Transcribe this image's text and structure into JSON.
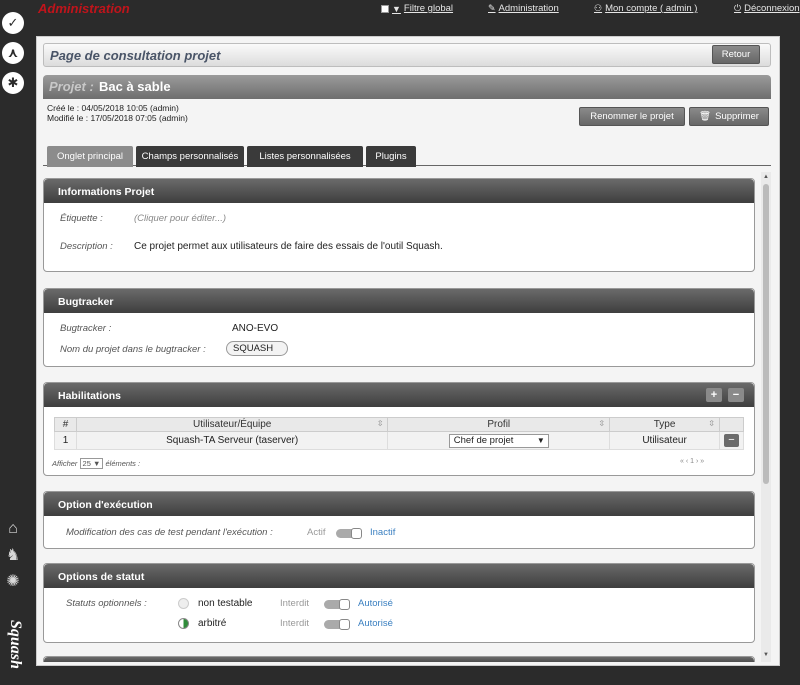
{
  "app": {
    "title": "Administration",
    "brand": "Squash"
  },
  "topnav": {
    "filtre": "Filtre global",
    "admin": "Administration",
    "compte": "Mon compte  ( admin )",
    "logout": "Déconnexion"
  },
  "page": {
    "title": "Page de consultation projet",
    "back": "Retour"
  },
  "project": {
    "label": "Projet  :",
    "name": "Bac à sable",
    "created": "Créé le :  04/05/2018 10:05 (admin)",
    "modified": "Modifié le :  17/05/2018 07:05 (admin)",
    "rename": "Renommer le projet",
    "delete": "Supprimer"
  },
  "tabs": [
    "Onglet principal",
    "Champs personnalisés",
    "Listes personnalisées",
    "Plugins"
  ],
  "info": {
    "title": "Informations Projet",
    "etiquette_label": "Étiquette  :",
    "etiquette_placeholder": "(Cliquer pour éditer...)",
    "description_label": "Description  :",
    "description": "Ce projet permet aux utilisateurs de faire des essais de l'outil Squash."
  },
  "bugtracker": {
    "title": "Bugtracker",
    "bt_label": "Bugtracker  :",
    "bt_value": "ANO-EVO",
    "proj_label": "Nom du projet dans le bugtracker  :",
    "proj_value": "SQUASH"
  },
  "habilitations": {
    "title": "Habilitations",
    "add": "+",
    "remove": "−",
    "columns": [
      "#",
      "Utilisateur/Équipe",
      "Profil",
      "Type"
    ],
    "rows": [
      {
        "num": "1",
        "user": "Squash-TA Serveur (taserver)",
        "profil": "Chef de projet",
        "type": "Utilisateur"
      }
    ],
    "show_prefix": "Afficher",
    "page_size": "25",
    "show_suffix": "éléments :",
    "pager": "« ‹ 1 › »"
  },
  "execution": {
    "title": "Option d'exécution",
    "label": "Modification des cas de test pendant l'exécution  :",
    "on": "Actif",
    "off": "Inactif"
  },
  "statut": {
    "title": "Options de statut",
    "label": "Statuts optionnels  :",
    "items": [
      {
        "name": "non testable",
        "off": "Interdit",
        "on": "Autorisé"
      },
      {
        "name": "arbitré",
        "off": "Interdit",
        "on": "Autorisé"
      }
    ]
  }
}
